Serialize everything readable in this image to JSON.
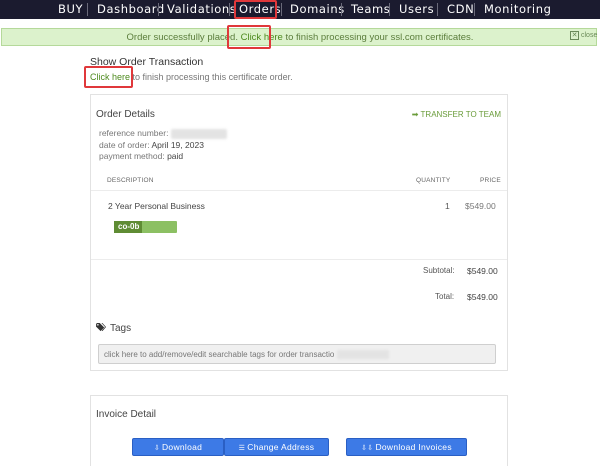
{
  "nav": {
    "items": [
      {
        "label": "BUY"
      },
      {
        "label": "Dashboard"
      },
      {
        "label": "Validations"
      },
      {
        "label": "Orders"
      },
      {
        "label": "Domains"
      },
      {
        "label": "Teams"
      },
      {
        "label": "Users"
      },
      {
        "label": "CDN"
      },
      {
        "label": "Monitoring"
      }
    ],
    "active": "Orders"
  },
  "banner": {
    "text_before": "Order successfully placed. ",
    "link": "Click here",
    "text_after": " to finish processing your ssl.com certificates.",
    "close_label": "close"
  },
  "page": {
    "title": "Show Order Transaction",
    "link": "Click here",
    "text_after": " to finish processing this certificate order."
  },
  "order": {
    "title": "Order Details",
    "transfer_label": "TRANSFER TO TEAM",
    "reference_label": "reference number:",
    "date_label": "date of order:",
    "date_value": "April 19, 2023",
    "payment_label": "payment method:",
    "payment_value": "paid",
    "columns": {
      "description": "DESCRIPTION",
      "quantity": "QUANTITY",
      "price": "PRICE"
    },
    "items": [
      {
        "name": "2 Year Personal Business",
        "quantity": "1",
        "price": "$549.00",
        "code": "co-0b"
      }
    ],
    "subtotal_label": "Subtotal:",
    "subtotal_value": "$549.00",
    "total_label": "Total:",
    "total_value": "$549.00"
  },
  "tags": {
    "title": "Tags",
    "placeholder": "click here to add/remove/edit searchable tags for order transactio"
  },
  "invoice": {
    "title": "Invoice Detail",
    "buttons": {
      "download": "Download",
      "change_address": "Change Address",
      "download_invoices": "Download Invoices"
    }
  },
  "colors": {
    "nav_bg": "#1b1b2f",
    "highlight": "#e0383b",
    "banner_bg": "#dcf2cc",
    "link": "#4d8a1e",
    "button": "#3d7ae6"
  }
}
